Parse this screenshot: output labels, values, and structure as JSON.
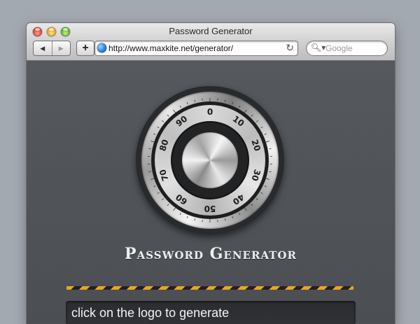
{
  "window": {
    "title": "Password Generator"
  },
  "toolbar": {
    "back_icon": "back-arrow-icon",
    "forward_icon": "forward-arrow-icon",
    "add_label": "+",
    "url": "http://www.maxkite.net/generator/",
    "search_placeholder": "Google"
  },
  "dial": {
    "numbers": [
      "0",
      "10",
      "20",
      "30",
      "40",
      "50",
      "60",
      "70",
      "80",
      "90"
    ]
  },
  "app": {
    "heading": "Password Generator",
    "output_text": "click on the logo to generate"
  },
  "colors": {
    "hazard_yellow": "#e8a623",
    "hazard_black": "#202122",
    "background": "#4b4f54"
  }
}
